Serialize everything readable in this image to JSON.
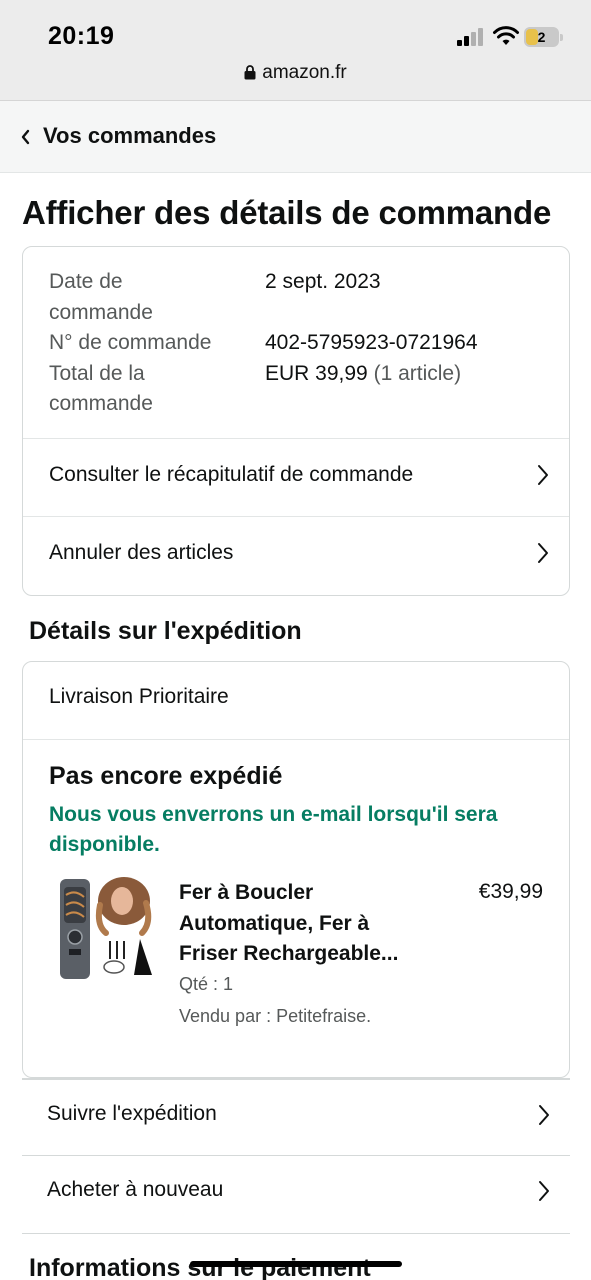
{
  "status_bar": {
    "time": "20:19",
    "battery": "2"
  },
  "browser": {
    "url": "amazon.fr"
  },
  "nav": {
    "back_label": "Vos commandes"
  },
  "page": {
    "title": "Afficher des détails de commande"
  },
  "order_summary": {
    "date_label_1": "Date de",
    "date_label_2": "commande",
    "date_value": "2 sept. 2023",
    "number_label": "N° de commande",
    "number_value": "402-5795923-0721964",
    "total_label_1": "Total de la",
    "total_label_2": "commande",
    "total_value": "EUR 39,99",
    "total_items": "(1 article)"
  },
  "actions": {
    "recap": "Consulter le récapitulatif de commande",
    "cancel": "Annuler des articles"
  },
  "shipping": {
    "section_title": "Détails sur l'expédition",
    "method": "Livraison Prioritaire",
    "status": "Pas encore expédié",
    "message": "Nous vous enverrons un e-mail lorsqu'il sera disponible.",
    "product": {
      "title": "Fer à Boucler Automatique, Fer à Friser Rechargeable...",
      "price": "€39,99",
      "quantity": "Qté : 1",
      "seller": "Vendu par : Petitefraise."
    }
  },
  "more_actions": {
    "track": "Suivre l'expédition",
    "buy_again": "Acheter à nouveau"
  },
  "payment": {
    "section_title": "Informations sur le paiement"
  },
  "colors": {
    "accent_green": "#067d62",
    "border": "#d5d9d9",
    "text": "#0f1111",
    "muted": "#565959"
  }
}
